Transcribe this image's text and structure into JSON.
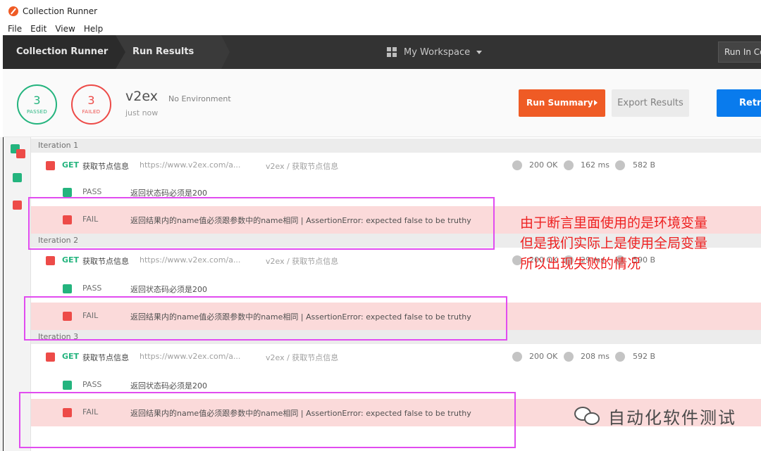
{
  "window": {
    "title": "Collection Runner"
  },
  "menu": [
    "File",
    "Edit",
    "View",
    "Help"
  ],
  "header": {
    "crumb_runner": "Collection Runner",
    "crumb_results": "Run Results",
    "workspace": "My Workspace",
    "run_in": "Run In Co"
  },
  "summary": {
    "passed_count": "3",
    "passed_label": "PASSED",
    "failed_count": "3",
    "failed_label": "FAILED",
    "collection": "v2ex",
    "environment": "No Environment",
    "time": "just now",
    "run_summary": "Run Summary",
    "export": "Export Results",
    "retry": "Retry"
  },
  "iterations": [
    {
      "label": "Iteration 1",
      "request": {
        "method": "GET",
        "name": "获取节点信息",
        "url": "https://www.v2ex.com/a...",
        "path": "v2ex / 获取节点信息",
        "status": "200 OK",
        "time": "162 ms",
        "size": "582 B"
      },
      "tests": [
        {
          "result": "PASS",
          "name": "返回状态码必须是200"
        },
        {
          "result": "FAIL",
          "name": "返回结果内的name值必须跟参数中的name相同 | AssertionError: expected false to be truthy"
        }
      ]
    },
    {
      "label": "Iteration 2",
      "request": {
        "method": "GET",
        "name": "获取节点信息",
        "url": "https://www.v2ex.com/a...",
        "path": "v2ex / 获取节点信息",
        "status": "200 OK",
        "time": "29 ms",
        "size": "590 B"
      },
      "tests": [
        {
          "result": "PASS",
          "name": "返回状态码必须是200"
        },
        {
          "result": "FAIL",
          "name": "返回结果内的name值必须跟参数中的name相同 | AssertionError: expected false to be truthy"
        }
      ]
    },
    {
      "label": "Iteration 3",
      "request": {
        "method": "GET",
        "name": "获取节点信息",
        "url": "https://www.v2ex.com/a...",
        "path": "v2ex / 获取节点信息",
        "status": "200 OK",
        "time": "208 ms",
        "size": "592 B"
      },
      "tests": [
        {
          "result": "PASS",
          "name": "返回状态码必须是200"
        },
        {
          "result": "FAIL",
          "name": "返回结果内的name值必须跟参数中的name相同 | AssertionError: expected false to be truthy"
        }
      ]
    }
  ],
  "annotation": {
    "lines": [
      "由于断言里面使用的是环境变量",
      "但是我们实际上是使用全局变量",
      "所以出现失败的情况"
    ]
  },
  "watermark": "自动化软件测试",
  "colors": {
    "pass": "#24b47e",
    "fail": "#ed4b48",
    "accent": "#ef5b25",
    "retry": "#097bed",
    "highlight": "#e14cf0",
    "note": "#ee2222"
  }
}
